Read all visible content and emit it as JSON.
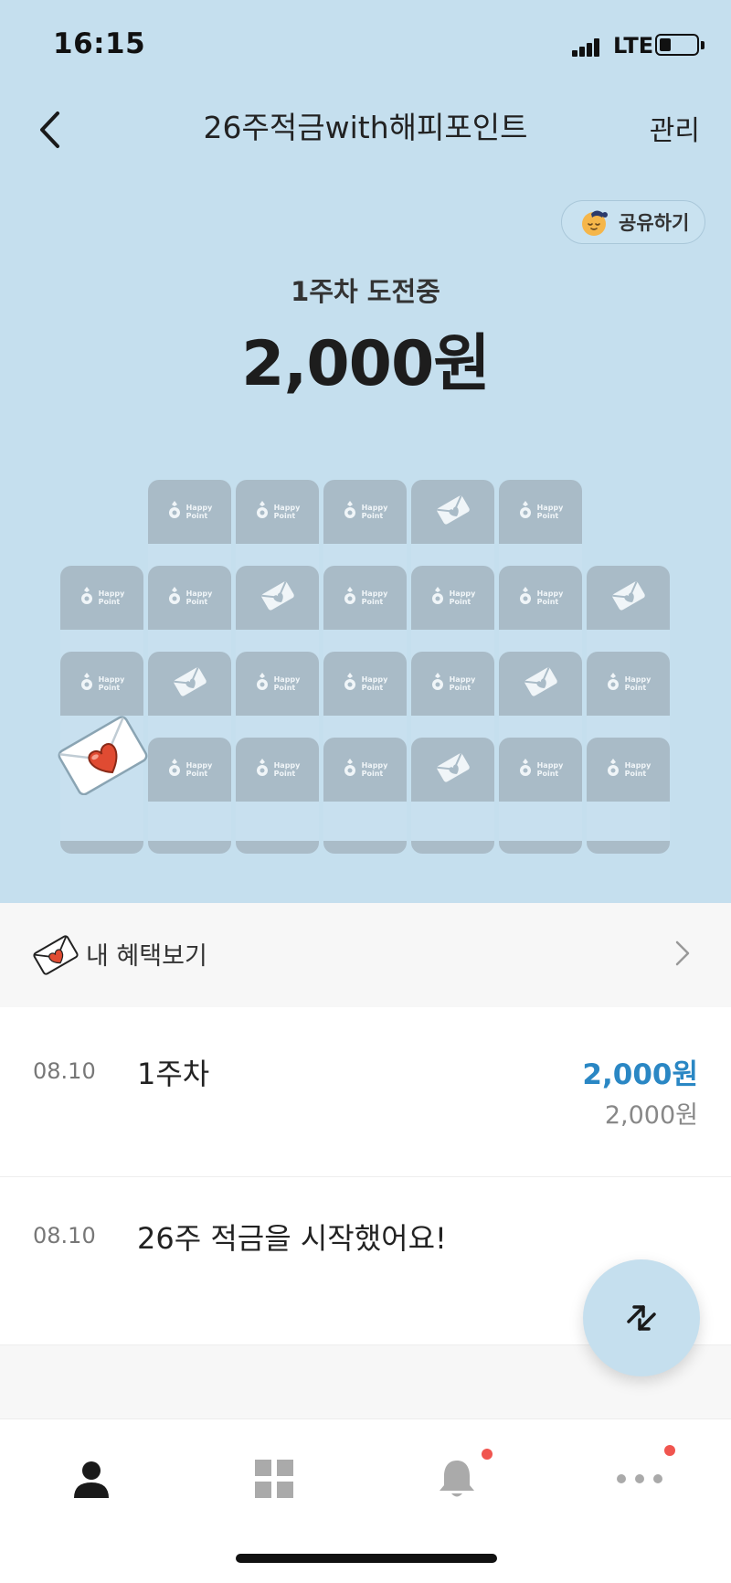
{
  "status_bar": {
    "time": "16:15",
    "network": "LTE"
  },
  "header": {
    "title": "26주적금with해피포인트",
    "manage_label": "관리"
  },
  "share": {
    "label": "공유하기"
  },
  "challenge": {
    "week_label": "1주차 도전중",
    "amount": "2,000원"
  },
  "grid": {
    "card_text_line1": "Happy",
    "card_text_line2": "Point"
  },
  "benefits": {
    "label": "내 혜택보기"
  },
  "history": [
    {
      "date": "08.10",
      "title": "1주차",
      "amount": "2,000원",
      "sub_amount": "2,000원"
    },
    {
      "date": "08.10",
      "title": "26주 적금을 시작했어요!"
    }
  ],
  "tabs": [
    {
      "name": "my",
      "icon": "person-icon",
      "active": true,
      "badge": false
    },
    {
      "name": "menu",
      "icon": "grid-icon",
      "active": false,
      "badge": false
    },
    {
      "name": "notifications",
      "icon": "bell-icon",
      "active": false,
      "badge": true
    },
    {
      "name": "more",
      "icon": "more-dots-icon",
      "active": false,
      "badge": true
    }
  ],
  "colors": {
    "hero_bg": "#c5dfee",
    "accent_blue": "#2a87c4",
    "badge_red": "#f0554f"
  }
}
